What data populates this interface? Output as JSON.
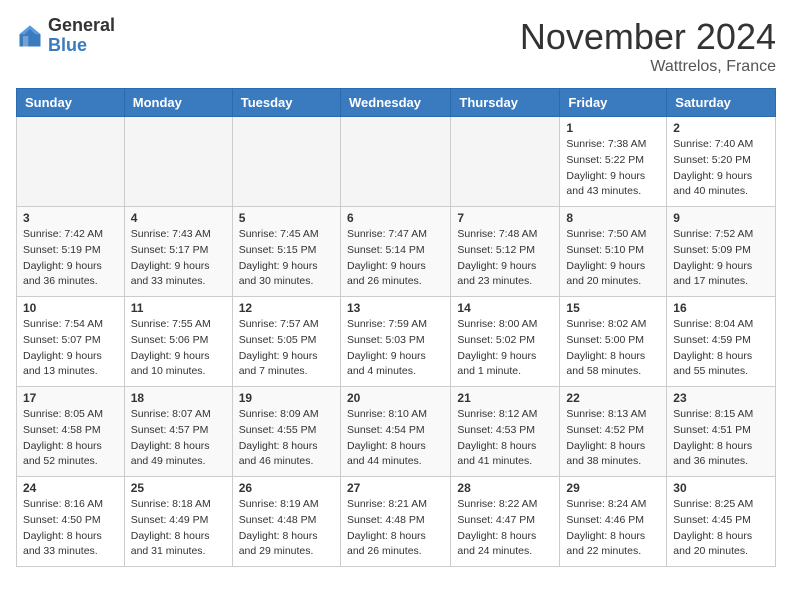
{
  "logo": {
    "general": "General",
    "blue": "Blue"
  },
  "header": {
    "month": "November 2024",
    "location": "Wattrelos, France"
  },
  "days_of_week": [
    "Sunday",
    "Monday",
    "Tuesday",
    "Wednesday",
    "Thursday",
    "Friday",
    "Saturday"
  ],
  "weeks": [
    [
      {
        "day": "",
        "info": ""
      },
      {
        "day": "",
        "info": ""
      },
      {
        "day": "",
        "info": ""
      },
      {
        "day": "",
        "info": ""
      },
      {
        "day": "",
        "info": ""
      },
      {
        "day": "1",
        "info": "Sunrise: 7:38 AM\nSunset: 5:22 PM\nDaylight: 9 hours and 43 minutes."
      },
      {
        "day": "2",
        "info": "Sunrise: 7:40 AM\nSunset: 5:20 PM\nDaylight: 9 hours and 40 minutes."
      }
    ],
    [
      {
        "day": "3",
        "info": "Sunrise: 7:42 AM\nSunset: 5:19 PM\nDaylight: 9 hours and 36 minutes."
      },
      {
        "day": "4",
        "info": "Sunrise: 7:43 AM\nSunset: 5:17 PM\nDaylight: 9 hours and 33 minutes."
      },
      {
        "day": "5",
        "info": "Sunrise: 7:45 AM\nSunset: 5:15 PM\nDaylight: 9 hours and 30 minutes."
      },
      {
        "day": "6",
        "info": "Sunrise: 7:47 AM\nSunset: 5:14 PM\nDaylight: 9 hours and 26 minutes."
      },
      {
        "day": "7",
        "info": "Sunrise: 7:48 AM\nSunset: 5:12 PM\nDaylight: 9 hours and 23 minutes."
      },
      {
        "day": "8",
        "info": "Sunrise: 7:50 AM\nSunset: 5:10 PM\nDaylight: 9 hours and 20 minutes."
      },
      {
        "day": "9",
        "info": "Sunrise: 7:52 AM\nSunset: 5:09 PM\nDaylight: 9 hours and 17 minutes."
      }
    ],
    [
      {
        "day": "10",
        "info": "Sunrise: 7:54 AM\nSunset: 5:07 PM\nDaylight: 9 hours and 13 minutes."
      },
      {
        "day": "11",
        "info": "Sunrise: 7:55 AM\nSunset: 5:06 PM\nDaylight: 9 hours and 10 minutes."
      },
      {
        "day": "12",
        "info": "Sunrise: 7:57 AM\nSunset: 5:05 PM\nDaylight: 9 hours and 7 minutes."
      },
      {
        "day": "13",
        "info": "Sunrise: 7:59 AM\nSunset: 5:03 PM\nDaylight: 9 hours and 4 minutes."
      },
      {
        "day": "14",
        "info": "Sunrise: 8:00 AM\nSunset: 5:02 PM\nDaylight: 9 hours and 1 minute."
      },
      {
        "day": "15",
        "info": "Sunrise: 8:02 AM\nSunset: 5:00 PM\nDaylight: 8 hours and 58 minutes."
      },
      {
        "day": "16",
        "info": "Sunrise: 8:04 AM\nSunset: 4:59 PM\nDaylight: 8 hours and 55 minutes."
      }
    ],
    [
      {
        "day": "17",
        "info": "Sunrise: 8:05 AM\nSunset: 4:58 PM\nDaylight: 8 hours and 52 minutes."
      },
      {
        "day": "18",
        "info": "Sunrise: 8:07 AM\nSunset: 4:57 PM\nDaylight: 8 hours and 49 minutes."
      },
      {
        "day": "19",
        "info": "Sunrise: 8:09 AM\nSunset: 4:55 PM\nDaylight: 8 hours and 46 minutes."
      },
      {
        "day": "20",
        "info": "Sunrise: 8:10 AM\nSunset: 4:54 PM\nDaylight: 8 hours and 44 minutes."
      },
      {
        "day": "21",
        "info": "Sunrise: 8:12 AM\nSunset: 4:53 PM\nDaylight: 8 hours and 41 minutes."
      },
      {
        "day": "22",
        "info": "Sunrise: 8:13 AM\nSunset: 4:52 PM\nDaylight: 8 hours and 38 minutes."
      },
      {
        "day": "23",
        "info": "Sunrise: 8:15 AM\nSunset: 4:51 PM\nDaylight: 8 hours and 36 minutes."
      }
    ],
    [
      {
        "day": "24",
        "info": "Sunrise: 8:16 AM\nSunset: 4:50 PM\nDaylight: 8 hours and 33 minutes."
      },
      {
        "day": "25",
        "info": "Sunrise: 8:18 AM\nSunset: 4:49 PM\nDaylight: 8 hours and 31 minutes."
      },
      {
        "day": "26",
        "info": "Sunrise: 8:19 AM\nSunset: 4:48 PM\nDaylight: 8 hours and 29 minutes."
      },
      {
        "day": "27",
        "info": "Sunrise: 8:21 AM\nSunset: 4:48 PM\nDaylight: 8 hours and 26 minutes."
      },
      {
        "day": "28",
        "info": "Sunrise: 8:22 AM\nSunset: 4:47 PM\nDaylight: 8 hours and 24 minutes."
      },
      {
        "day": "29",
        "info": "Sunrise: 8:24 AM\nSunset: 4:46 PM\nDaylight: 8 hours and 22 minutes."
      },
      {
        "day": "30",
        "info": "Sunrise: 8:25 AM\nSunset: 4:45 PM\nDaylight: 8 hours and 20 minutes."
      }
    ]
  ]
}
